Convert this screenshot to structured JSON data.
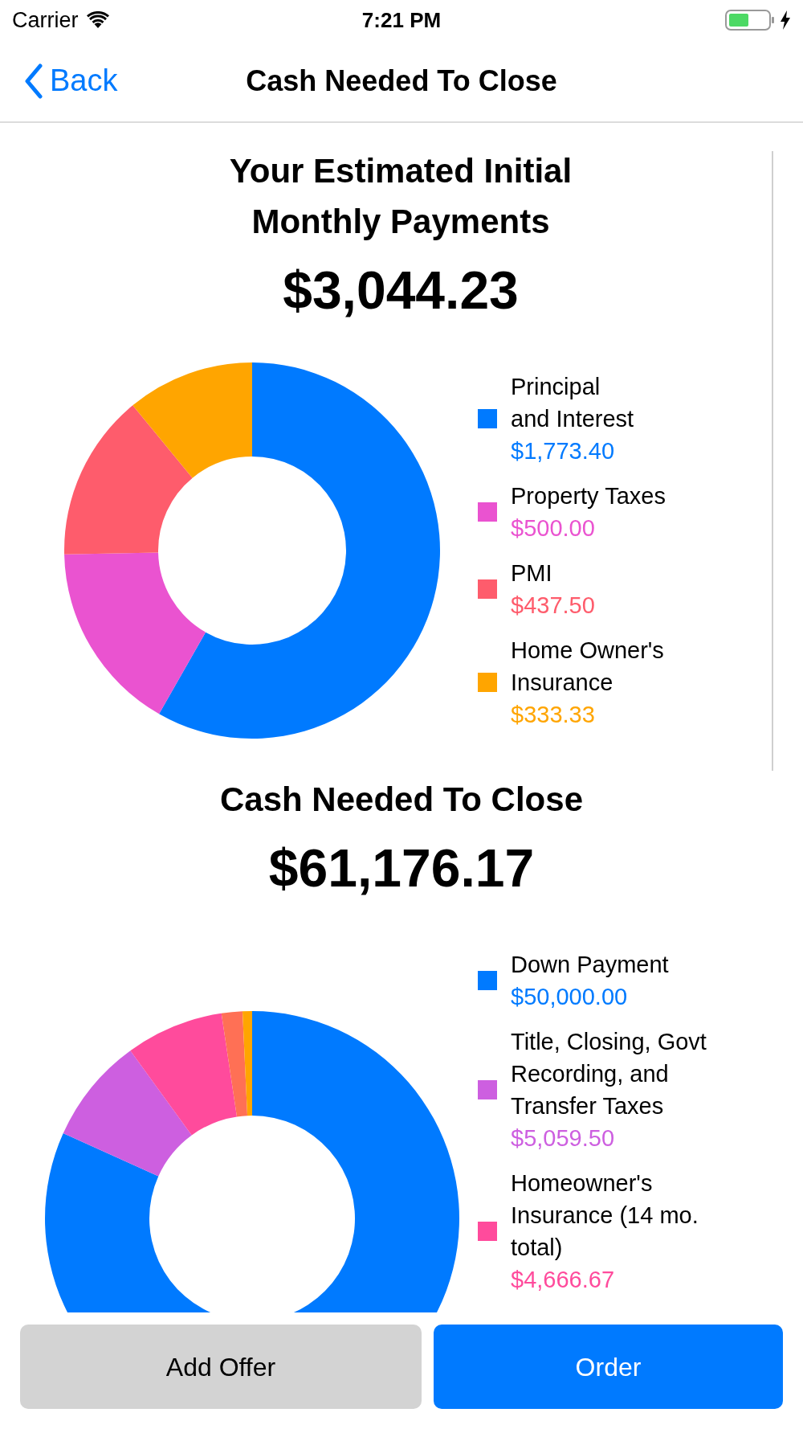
{
  "status_bar": {
    "carrier": "Carrier",
    "time": "7:21 PM"
  },
  "nav": {
    "back": "Back",
    "title": "Cash Needed To Close"
  },
  "sections": [
    {
      "title_lines": [
        "Your Estimated Initial",
        "Monthly Payments"
      ],
      "amount": "$3,044.23",
      "chart_data": {
        "type": "donut",
        "values": [
          58.25,
          16.42,
          14.37,
          10.96
        ],
        "colors": [
          "#007aff",
          "#ea53d0",
          "#fe5c6c",
          "#ffa500"
        ]
      },
      "legend": [
        {
          "label_lines": [
            "Principal",
            "and Interest"
          ],
          "value": "$1,773.40",
          "color": "#007aff"
        },
        {
          "label_lines": [
            "Property Taxes"
          ],
          "value": "$500.00",
          "color": "#ea53d0"
        },
        {
          "label_lines": [
            "PMI"
          ],
          "value": "$437.50",
          "color": "#fe5c6c"
        },
        {
          "label_lines": [
            "Home Owner's",
            "Insurance"
          ],
          "value": "$333.33",
          "color": "#ffa500"
        }
      ]
    },
    {
      "title_lines": [
        "Cash Needed To Close"
      ],
      "amount": "$61,176.17",
      "chart_data": {
        "type": "donut",
        "values": [
          81.73,
          8.27,
          7.63,
          1.63,
          0.74
        ],
        "colors": [
          "#007aff",
          "#cd5fe0",
          "#ff4b9c",
          "#ff7055",
          "#ffa500"
        ]
      },
      "legend": [
        {
          "label_lines": [
            "Down Payment"
          ],
          "value": "$50,000.00",
          "color": "#007aff"
        },
        {
          "label_lines": [
            "Title, Closing, Govt",
            "Recording, and",
            "Transfer Taxes"
          ],
          "value": "$5,059.50",
          "color": "#cd5fe0"
        },
        {
          "label_lines": [
            "Homeowner's",
            "Insurance (14 mo.",
            "total)"
          ],
          "value": "$4,666.67",
          "color": "#ff4b9c"
        }
      ]
    }
  ],
  "buttons": [
    {
      "label": "Add Offer",
      "kind": "secondary"
    },
    {
      "label": "Order",
      "kind": "primary"
    }
  ]
}
